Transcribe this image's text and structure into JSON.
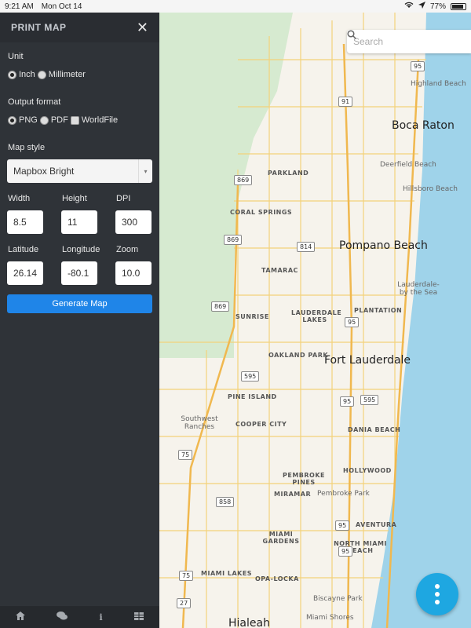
{
  "status": {
    "time": "9:21 AM",
    "date": "Mon Oct 14",
    "battery": "77%"
  },
  "sidebar": {
    "title": "PRINT MAP",
    "unit": {
      "label": "Unit",
      "options": [
        "Inch",
        "Millimeter"
      ],
      "selected": "Inch"
    },
    "format": {
      "label": "Output format",
      "options": [
        "PNG",
        "PDF",
        "WorldFile"
      ],
      "selected": "PNG"
    },
    "style": {
      "label": "Map style",
      "value": "Mapbox Bright"
    },
    "width": {
      "label": "Width",
      "value": "8.5"
    },
    "height": {
      "label": "Height",
      "value": "11"
    },
    "dpi": {
      "label": "DPI",
      "value": "300"
    },
    "latitude": {
      "label": "Latitude",
      "value": "26.14"
    },
    "longitude": {
      "label": "Longitude",
      "value": "-80.1"
    },
    "zoom": {
      "label": "Zoom",
      "value": "10.0"
    },
    "generate": "Generate Map",
    "footer_icons": [
      "home-icon",
      "chat-icon",
      "info-icon",
      "table-icon"
    ]
  },
  "map": {
    "search_placeholder": "Search",
    "cities": [
      "Boca Raton",
      "Pompano Beach",
      "Fort Lauderdale",
      "Hialeah"
    ],
    "towns": [
      "PARKLAND",
      "CORAL SPRINGS",
      "TAMARAC",
      "SUNRISE",
      "LAUDERDALE LAKES",
      "PLANTATION",
      "OAKLAND PARK",
      "PINE ISLAND",
      "COOPER CITY",
      "DANIA BEACH",
      "HOLLYWOOD",
      "PEMBROKE PINES",
      "MIRAMAR",
      "MIAMI GARDENS",
      "MIAMI LAKES",
      "OPA-LOCKA",
      "NORTH MIAMI BEACH",
      "AVENTURA"
    ],
    "small": [
      "Highland Beach",
      "Deerfield Beach",
      "Hillsboro Beach",
      "Lauderdale-by the Sea",
      "Southwest Ranches",
      "Pembroke Park",
      "Biscayne Park",
      "Miami Shores"
    ],
    "shields": [
      "95",
      "91",
      "869",
      "869",
      "814",
      "869",
      "95",
      "595",
      "95",
      "595",
      "75",
      "858",
      "95",
      "95",
      "75",
      "27"
    ]
  }
}
